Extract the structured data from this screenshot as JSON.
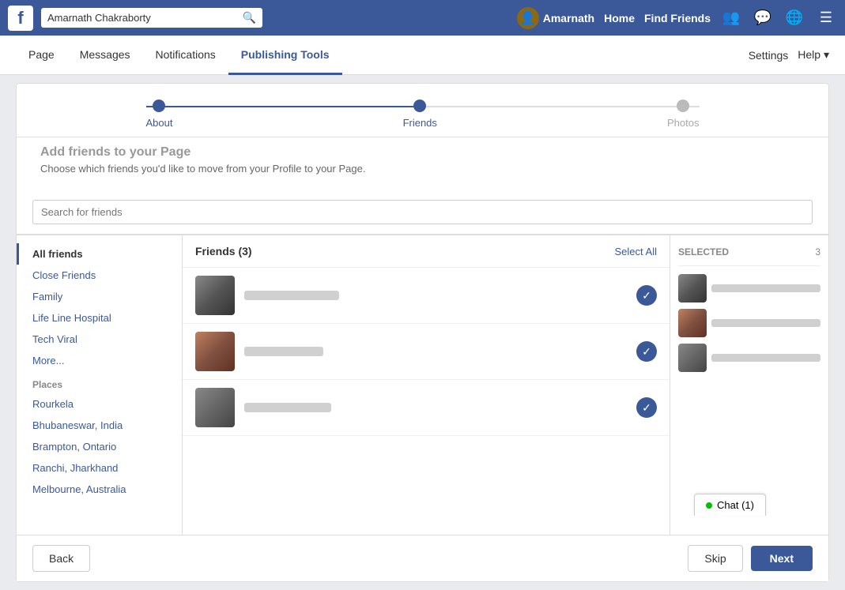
{
  "topNav": {
    "logo": "f",
    "searchPlaceholder": "Amarnath Chakraborty",
    "userName": "Amarnath",
    "homeLabel": "Home",
    "findFriendsLabel": "Find Friends"
  },
  "secondaryNav": {
    "items": [
      {
        "label": "Page",
        "active": false
      },
      {
        "label": "Messages",
        "active": false
      },
      {
        "label": "Notifications",
        "active": false
      },
      {
        "label": "Publishing Tools",
        "active": true
      }
    ],
    "settingsLabel": "Settings",
    "helpLabel": "Help"
  },
  "progress": {
    "steps": [
      {
        "label": "About",
        "state": "completed"
      },
      {
        "label": "Friends",
        "state": "active"
      },
      {
        "label": "Photos",
        "state": "inactive"
      }
    ]
  },
  "addFriends": {
    "title": "Add friends to your Page",
    "subtitle": "Choose which friends you'd like to move from your Profile to your Page."
  },
  "searchBar": {
    "placeholder": "Search for friends"
  },
  "sidebar": {
    "items": [
      {
        "label": "All friends",
        "active": true
      },
      {
        "label": "Close Friends",
        "active": false
      },
      {
        "label": "Family",
        "active": false
      },
      {
        "label": "Life Line Hospital",
        "active": false
      },
      {
        "label": "Tech Viral",
        "active": false
      },
      {
        "label": "More...",
        "active": false
      }
    ],
    "placesLabel": "Places",
    "places": [
      {
        "label": "Rourkela"
      },
      {
        "label": "Bhubaneswar, India"
      },
      {
        "label": "Brampton, Ontario"
      },
      {
        "label": "Ranchi, Jharkhand"
      },
      {
        "label": "Melbourne, Australia"
      }
    ]
  },
  "friendsList": {
    "title": "Friends (3)",
    "selectAllLabel": "Select All",
    "friends": [
      {
        "checked": true
      },
      {
        "checked": true
      },
      {
        "checked": true
      }
    ]
  },
  "selected": {
    "label": "SELECTED",
    "count": "3",
    "items": [
      {},
      {},
      {}
    ]
  },
  "buttons": {
    "back": "Back",
    "skip": "Skip",
    "next": "Next"
  },
  "chat": {
    "label": "Chat (1)"
  }
}
